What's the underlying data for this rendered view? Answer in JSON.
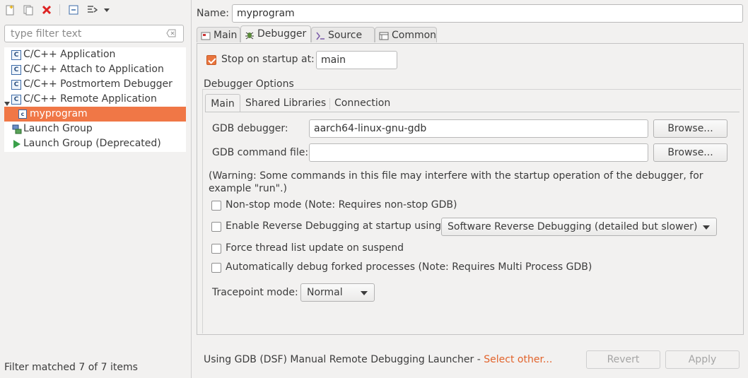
{
  "left": {
    "filter_placeholder": "type filter text",
    "tree": [
      {
        "label": "C/C++ Application",
        "icon": "c-app-icon",
        "selected": false
      },
      {
        "label": "C/C++ Attach to Application",
        "icon": "c-app-icon",
        "selected": false
      },
      {
        "label": "C/C++ Postmortem Debugger",
        "icon": "c-app-icon",
        "selected": false
      },
      {
        "label": "C/C++ Remote Application",
        "icon": "c-app-icon",
        "selected": false,
        "expanded": true
      },
      {
        "label": "myprogram",
        "icon": "c-file-icon",
        "selected": true
      },
      {
        "label": "Launch Group",
        "icon": "launch-group-icon",
        "selected": false
      },
      {
        "label": "Launch Group (Deprecated)",
        "icon": "run-icon",
        "selected": false
      }
    ],
    "status": "Filter matched 7 of 7 items"
  },
  "right": {
    "name_label": "Name:",
    "name_value": "myprogram",
    "tabs": [
      {
        "label": "Main",
        "icon": "main-tab-icon"
      },
      {
        "label": "Debugger",
        "icon": "bug-icon",
        "active": true
      },
      {
        "label": "Source",
        "icon": "source-icon"
      },
      {
        "label": "Common",
        "icon": "common-icon"
      }
    ],
    "stop_on_startup_label": "Stop on startup at:",
    "stop_on_startup_checked": true,
    "stop_on_startup_value": "main",
    "debugger_options_title": "Debugger Options",
    "subtabs": [
      "Main",
      "Shared Libraries",
      "Connection"
    ],
    "gdb_debugger_label": "GDB debugger:",
    "gdb_debugger_value": "aarch64-linux-gnu-gdb",
    "gdb_command_label": "GDB command file:",
    "gdb_command_value": "",
    "browse_label": "Browse...",
    "warning_text": "(Warning: Some commands in this file may interfere with the startup operation of the debugger, for example \"run\".)",
    "non_stop_label": "Non-stop mode (Note: Requires non-stop GDB)",
    "reverse_label": "Enable Reverse Debugging at startup using:",
    "reverse_option": "Software Reverse Debugging (detailed but slower)",
    "force_thread_label": "Force thread list update on suspend",
    "auto_debug_label": "Automatically debug forked processes (Note: Requires Multi Process GDB)",
    "tracepoint_label": "Tracepoint mode:",
    "tracepoint_value": "Normal",
    "launcher_text": "Using GDB (DSF) Manual Remote Debugging Launcher - ",
    "select_other": "Select other...",
    "revert_label": "Revert",
    "apply_label": "Apply"
  },
  "colors": {
    "accent": "#f07746",
    "link": "#e2632b",
    "check": "#e9753e"
  }
}
